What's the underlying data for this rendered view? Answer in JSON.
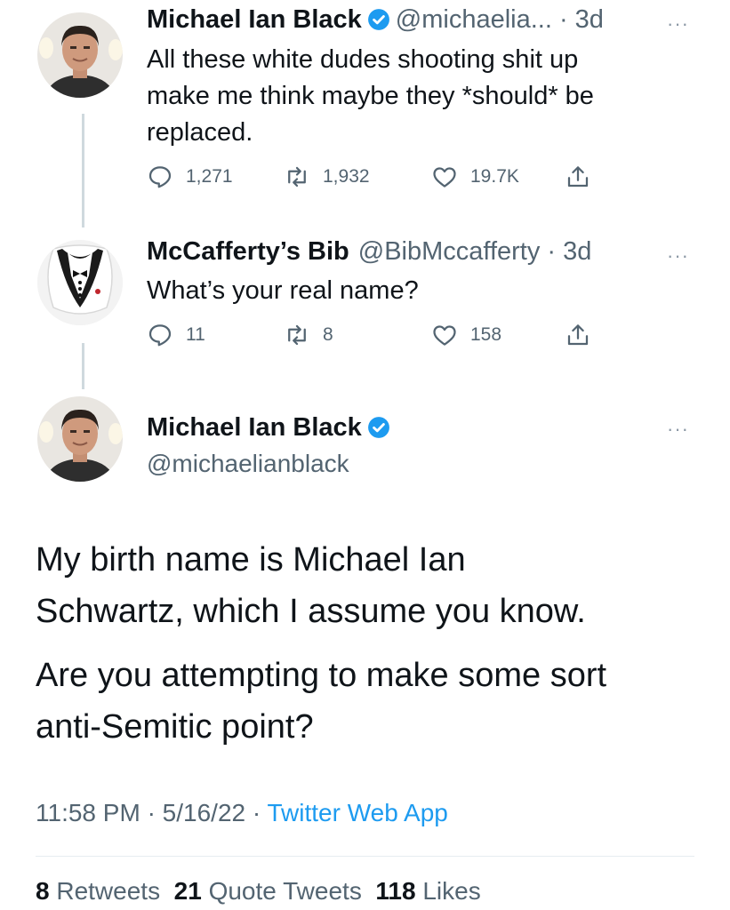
{
  "colors": {
    "accent": "#1d9bf0",
    "secondary_text": "#536471",
    "primary_text": "#0f1419",
    "verified": "#1d9bf0"
  },
  "tweet1": {
    "name": "Michael Ian Black",
    "handle_time": "@michaelia... · 3d",
    "more": "···",
    "text_lines": [
      "All these white dudes shooting shit up",
      "make me think maybe they *should* be",
      "replaced."
    ],
    "reply_count": "1,271",
    "retweet_count": "1,932",
    "like_count": "19.7K"
  },
  "tweet2": {
    "name": "McCafferty’s Bib",
    "handle_time": "@BibMccafferty · 3d",
    "more": "···",
    "text": "What’s your real name?",
    "reply_count": "11",
    "retweet_count": "8",
    "like_count": "158"
  },
  "main_tweet": {
    "name": "Michael Ian Black",
    "handle": "@michaelianblack",
    "more": "···",
    "paragraph1_lines": [
      "My birth name is Michael Ian",
      "Schwartz, which I assume you know."
    ],
    "paragraph2_lines": [
      "Are you attempting to make some sort",
      "anti-Semitic point?"
    ],
    "time": "11:58 PM",
    "date": "5/16/22",
    "source": "Twitter Web App",
    "retweets_count": "8",
    "retweets_label": "Retweets",
    "quotes_count": "21",
    "quotes_label": "Quote Tweets",
    "likes_count": "118",
    "likes_label": "Likes"
  }
}
